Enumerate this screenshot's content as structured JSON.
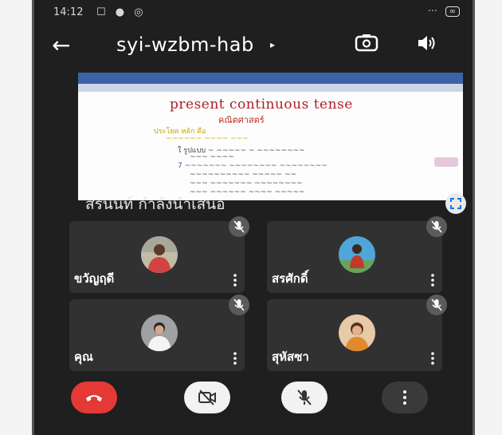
{
  "status": {
    "time": "14:12",
    "left_icons": "☐ ● ◎",
    "right_text": "⋯",
    "battery": "∞"
  },
  "top_bar": {
    "meeting_code": "syi-wzbm-hab",
    "caret": "▸"
  },
  "presentation": {
    "title": "present continuous tense",
    "subtitle": "คณิตศาสตร์",
    "lines": [
      "ประโยค หลัก คือ",
      "~~~~~~ ~~~~ ~~~",
      "ใ รูปแบบ ~ ~~~~~ ~ ~~~~~~~~",
      "~~~ ~~~~",
      "7 ~~~~~~~ ~~~~~~~~ ~~~~~~~~",
      "~~~~~~~~~~ ~~~~~ ~~",
      "~~~ ~~~~~~~ ~~~~~~~~",
      "~~~ ~~~~~~ ~~~~ ~~~~~"
    ]
  },
  "presenting_label": "สรนนท์ กำลังนำเสนอ",
  "participants": [
    {
      "name": "ขวัญฤดี"
    },
    {
      "name": "สรศักดิ์"
    },
    {
      "name": "คุณ"
    },
    {
      "name": "สุหัสซา"
    }
  ],
  "colors": {
    "hangup": "#e53935",
    "control_light": "#f2f2f2",
    "control_dark": "#3a3a3a",
    "background": "#1f1f1f",
    "tile": "#313131"
  },
  "icons": {
    "back": "←",
    "hangup": "phone-hangup-icon",
    "camera_off": "camera-off-icon",
    "mic_off": "mic-off-icon",
    "more": "more-vert-icon"
  }
}
